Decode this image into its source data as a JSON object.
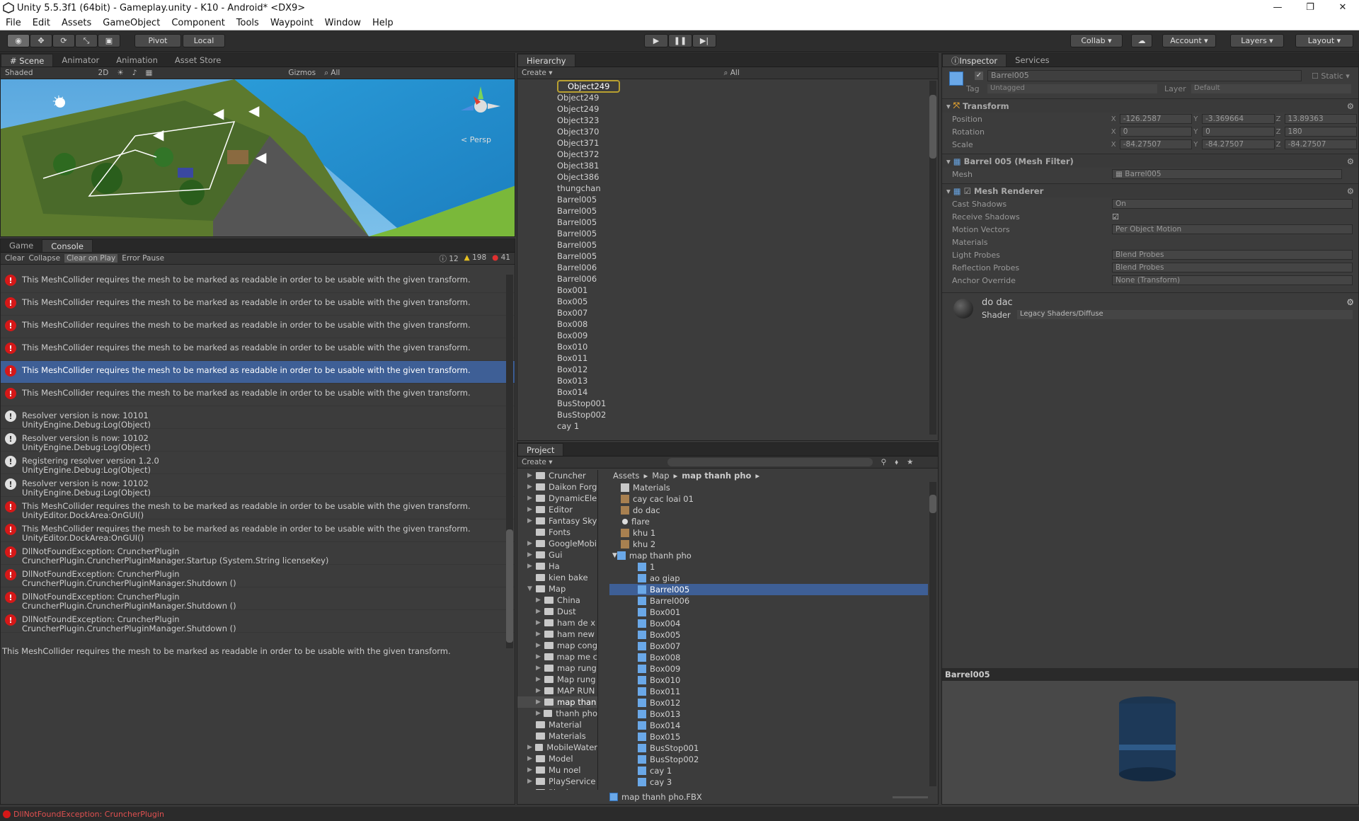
{
  "window": {
    "title": "Unity 5.5.3f1 (64bit) - Gameplay.unity - K10 - Android* <DX9>"
  },
  "menu": [
    "File",
    "Edit",
    "Assets",
    "GameObject",
    "Component",
    "Tools",
    "Waypoint",
    "Window",
    "Help"
  ],
  "toolbar": {
    "pivot": "Pivot",
    "local": "Local",
    "collab": "Collab",
    "account": "Account",
    "layers": "Layers",
    "layout": "Layout"
  },
  "scene": {
    "tabs": [
      "Scene",
      "Animator",
      "Animation",
      "Asset Store"
    ],
    "shading": "Shaded",
    "mode_2d": "2D",
    "gizmos": "Gizmos",
    "search_placeholder": "All",
    "persp": "< Persp"
  },
  "console": {
    "tabs": [
      "Game",
      "Console"
    ],
    "buttons": [
      "Clear",
      "Collapse",
      "Clear on Play",
      "Error Pause"
    ],
    "counts": {
      "info": "12",
      "warn": "198",
      "error": "41"
    },
    "messages": [
      {
        "type": "err",
        "text": "This MeshCollider requires the mesh to be marked as readable in order to be usable with the given transform."
      },
      {
        "type": "err",
        "text": "This MeshCollider requires the mesh to be marked as readable in order to be usable with the given transform."
      },
      {
        "type": "err",
        "text": "This MeshCollider requires the mesh to be marked as readable in order to be usable with the given transform."
      },
      {
        "type": "err",
        "text": "This MeshCollider requires the mesh to be marked as readable in order to be usable with the given transform."
      },
      {
        "type": "err",
        "text": "This MeshCollider requires the mesh to be marked as readable in order to be usable with the given transform.",
        "selected": true
      },
      {
        "type": "err",
        "text": "This MeshCollider requires the mesh to be marked as readable in order to be usable with the given transform."
      },
      {
        "type": "info",
        "text": "Resolver version is now: 10101\nUnityEngine.Debug:Log(Object)"
      },
      {
        "type": "info",
        "text": "Resolver version is now: 10102\nUnityEngine.Debug:Log(Object)"
      },
      {
        "type": "info",
        "text": "Registering resolver version 1.2.0\nUnityEngine.Debug:Log(Object)"
      },
      {
        "type": "info",
        "text": "Resolver version is now: 10102\nUnityEngine.Debug:Log(Object)"
      },
      {
        "type": "err",
        "text": "This MeshCollider requires the mesh to be marked as readable in order to be usable with the given transform.\nUnityEditor.DockArea:OnGUI()"
      },
      {
        "type": "err",
        "text": "This MeshCollider requires the mesh to be marked as readable in order to be usable with the given transform.\nUnityEditor.DockArea:OnGUI()"
      },
      {
        "type": "err",
        "text": "DllNotFoundException: CruncherPlugin\nCruncherPlugin.CruncherPluginManager.Startup (System.String licenseKey)"
      },
      {
        "type": "err",
        "text": "DllNotFoundException: CruncherPlugin\nCruncherPlugin.CruncherPluginManager.Shutdown ()"
      },
      {
        "type": "err",
        "text": "DllNotFoundException: CruncherPlugin\nCruncherPlugin.CruncherPluginManager.Shutdown ()"
      },
      {
        "type": "err",
        "text": "DllNotFoundException: CruncherPlugin\nCruncherPlugin.CruncherPluginManager.Shutdown ()"
      }
    ],
    "detail": "This MeshCollider requires the mesh to be marked as readable in order to be usable with the given transform."
  },
  "hierarchy": {
    "tab": "Hierarchy",
    "create": "Create",
    "search_placeholder": "All",
    "items": [
      "Object249",
      "Object249",
      "Object249",
      "Object323",
      "Object370",
      "Object371",
      "Object372",
      "Object381",
      "Object386",
      "thungchan",
      "Barrel005",
      "Barrel005",
      "Barrel005",
      "Barrel005",
      "Barrel005",
      "Barrel005",
      "Barrel006",
      "Barrel006",
      "Box001",
      "Box005",
      "Box007",
      "Box008",
      "Box009",
      "Box010",
      "Box011",
      "Box012",
      "Box013",
      "Box014",
      "BusStop001",
      "BusStop002",
      "cay 1"
    ]
  },
  "project": {
    "tab": "Project",
    "create": "Create",
    "breadcrumb": [
      "Assets",
      "Map",
      "map thanh pho"
    ],
    "tree": [
      {
        "label": "Cruncher",
        "depth": 0,
        "arrow": true
      },
      {
        "label": "Daikon Forg",
        "depth": 0,
        "arrow": true
      },
      {
        "label": "DynamicEle",
        "depth": 0,
        "arrow": true
      },
      {
        "label": "Editor",
        "depth": 0,
        "arrow": true
      },
      {
        "label": "Fantasy Sky",
        "depth": 0,
        "arrow": true
      },
      {
        "label": "Fonts",
        "depth": 0,
        "arrow": false
      },
      {
        "label": "GoogleMobi",
        "depth": 0,
        "arrow": true
      },
      {
        "label": "Gui",
        "depth": 0,
        "arrow": true
      },
      {
        "label": "Ha",
        "depth": 0,
        "arrow": true
      },
      {
        "label": "kien bake",
        "depth": 0,
        "arrow": false
      },
      {
        "label": "Map",
        "depth": 0,
        "arrow": true,
        "open": true
      },
      {
        "label": "China",
        "depth": 1,
        "arrow": true
      },
      {
        "label": "Dust",
        "depth": 1,
        "arrow": true
      },
      {
        "label": "ham de x",
        "depth": 1,
        "arrow": true
      },
      {
        "label": "ham new",
        "depth": 1,
        "arrow": true
      },
      {
        "label": "map cong",
        "depth": 1,
        "arrow": true
      },
      {
        "label": "map me c",
        "depth": 1,
        "arrow": true
      },
      {
        "label": "map rung",
        "depth": 1,
        "arrow": true
      },
      {
        "label": "Map rung",
        "depth": 1,
        "arrow": true
      },
      {
        "label": "MAP RUN",
        "depth": 1,
        "arrow": true
      },
      {
        "label": "map than",
        "depth": 1,
        "arrow": true,
        "selected": true
      },
      {
        "label": "thanh pho",
        "depth": 1,
        "arrow": true
      },
      {
        "label": "Material",
        "depth": 0,
        "arrow": false
      },
      {
        "label": "Materials",
        "depth": 0,
        "arrow": false
      },
      {
        "label": "MobileWater",
        "depth": 0,
        "arrow": true
      },
      {
        "label": "Model",
        "depth": 0,
        "arrow": true
      },
      {
        "label": "Mu noel",
        "depth": 0,
        "arrow": true
      },
      {
        "label": "PlayService",
        "depth": 0,
        "arrow": true
      },
      {
        "label": "Plugins",
        "depth": 0,
        "arrow": true
      }
    ],
    "assets": [
      {
        "label": "Materials",
        "kind": "folder",
        "depth": 0
      },
      {
        "label": "cay cac loai 01",
        "kind": "tex",
        "depth": 0
      },
      {
        "label": "do dac",
        "kind": "tex",
        "depth": 0
      },
      {
        "label": "flare",
        "kind": "flare",
        "depth": 0
      },
      {
        "label": "khu 1",
        "kind": "tex",
        "depth": 0
      },
      {
        "label": "khu 2",
        "kind": "tex",
        "depth": 0
      },
      {
        "label": "map thanh pho",
        "kind": "model",
        "depth": 0,
        "open": true
      },
      {
        "label": "1",
        "kind": "mesh",
        "depth": 1
      },
      {
        "label": "ao giap",
        "kind": "mesh",
        "depth": 1
      },
      {
        "label": "Barrel005",
        "kind": "mesh",
        "depth": 1,
        "selected": true
      },
      {
        "label": "Barrel006",
        "kind": "mesh",
        "depth": 1
      },
      {
        "label": "Box001",
        "kind": "mesh",
        "depth": 1
      },
      {
        "label": "Box004",
        "kind": "mesh",
        "depth": 1
      },
      {
        "label": "Box005",
        "kind": "mesh",
        "depth": 1
      },
      {
        "label": "Box007",
        "kind": "mesh",
        "depth": 1
      },
      {
        "label": "Box008",
        "kind": "mesh",
        "depth": 1
      },
      {
        "label": "Box009",
        "kind": "mesh",
        "depth": 1
      },
      {
        "label": "Box010",
        "kind": "mesh",
        "depth": 1
      },
      {
        "label": "Box011",
        "kind": "mesh",
        "depth": 1
      },
      {
        "label": "Box012",
        "kind": "mesh",
        "depth": 1
      },
      {
        "label": "Box013",
        "kind": "mesh",
        "depth": 1
      },
      {
        "label": "Box014",
        "kind": "mesh",
        "depth": 1
      },
      {
        "label": "Box015",
        "kind": "mesh",
        "depth": 1
      },
      {
        "label": "BusStop001",
        "kind": "mesh",
        "depth": 1
      },
      {
        "label": "BusStop002",
        "kind": "mesh",
        "depth": 1
      },
      {
        "label": "cay 1",
        "kind": "mesh",
        "depth": 1
      },
      {
        "label": "cay 3",
        "kind": "mesh",
        "depth": 1
      }
    ],
    "footer": "map thanh pho.FBX"
  },
  "inspector": {
    "tabs": [
      "Inspector",
      "Services"
    ],
    "object_name": "Barrel005",
    "static_label": "Static",
    "tag_label": "Tag",
    "tag_value": "Untagged",
    "layer_label": "Layer",
    "layer_value": "Default",
    "transform": {
      "title": "Transform",
      "position_label": "Position",
      "position": {
        "x": "-126.2587",
        "y": "-3.369664",
        "z": "13.89363"
      },
      "rotation_label": "Rotation",
      "rotation": {
        "x": "0",
        "y": "0",
        "z": "180"
      },
      "scale_label": "Scale",
      "scale": {
        "x": "-84.27507",
        "y": "-84.27507",
        "z": "-84.27507"
      }
    },
    "mesh_filter": {
      "title": "Barrel 005 (Mesh Filter)",
      "mesh_label": "Mesh",
      "mesh_value": "Barrel005"
    },
    "mesh_renderer": {
      "title": "Mesh Renderer",
      "cast_shadows_label": "Cast Shadows",
      "cast_shadows": "On",
      "receive_shadows_label": "Receive Shadows",
      "motion_vectors_label": "Motion Vectors",
      "motion_vectors": "Per Object Motion",
      "materials_label": "Materials",
      "light_probes_label": "Light Probes",
      "light_probes": "Blend Probes",
      "reflection_probes_label": "Reflection Probes",
      "reflection_probes": "Blend Probes",
      "anchor_override_label": "Anchor Override",
      "anchor_override": "None (Transform)"
    },
    "material": {
      "name": "do dac",
      "shader_label": "Shader",
      "shader": "Legacy Shaders/Diffuse"
    },
    "preview_title": "Barrel005"
  },
  "status": {
    "text": "DllNotFoundException: CruncherPlugin"
  },
  "colors": {
    "selection": "#3e5f96",
    "error": "#d61818",
    "accent": "#b8a030"
  }
}
